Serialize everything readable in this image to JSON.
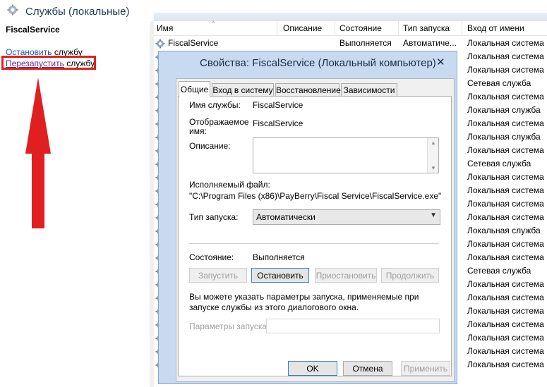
{
  "header": {
    "title": "Службы (локальные)"
  },
  "left_pane": {
    "service_name": "FiscalService",
    "stop_link": "Остановить",
    "stop_suffix": " службу",
    "restart_link": "Перезапустить",
    "restart_suffix": " службу"
  },
  "list": {
    "columns": {
      "name": "Имя",
      "description": "Описание",
      "status": "Состояние",
      "startup_type": "Тип запуска",
      "logon": "Вход от имени"
    },
    "first_row": {
      "name": "FiscalService",
      "status": "Выполняется",
      "startup_type": "Автоматиче..."
    },
    "logon_values": [
      "Локальная система",
      "Локальная система",
      "Локальная система",
      "Сетевая служба",
      "Локальная система",
      "Локальная служба",
      "Локальная система",
      "Локальная служба",
      "Локальная система",
      "Сетевая служба",
      "Локальная система",
      "Локальная система",
      "Локальная система",
      "Локальная система",
      "Локальная служба",
      "Локальная система",
      "Локальная система",
      "Сетевая служба",
      "Локальная система",
      "Локальная система",
      "Локальная система",
      "Локальная система",
      "Локальная система",
      "Локальная система",
      "Локальная система"
    ]
  },
  "dialog": {
    "title": "Свойства: FiscalService (Локальный компьютер)",
    "close": "✕",
    "tabs": [
      "Общие",
      "Вход в систему",
      "Восстановление",
      "Зависимости"
    ],
    "service_name_label": "Имя службы:",
    "service_name_value": "FiscalService",
    "display_name_label_1": "Отображаемое",
    "display_name_label_2": "имя:",
    "display_name_value": "FiscalService",
    "description_label": "Описание:",
    "exe_label": "Исполняемый файл:",
    "exe_value": "\"C:\\Program Files (x86)\\PayBerry\\Fiscal Service\\FiscalService.exe\"",
    "startup_label": "Тип запуска:",
    "startup_value": "Автоматически",
    "state_label": "Состояние:",
    "state_value": "Выполняется",
    "buttons": {
      "start": "Запустить",
      "stop": "Остановить",
      "pause": "Приостановить",
      "resume": "Продолжить"
    },
    "note": "Вы можете указать параметры запуска, применяемые при запуске службы из этого диалогового окна.",
    "params_label": "Параметры запуска:",
    "ok": "OK",
    "cancel": "Отмена",
    "apply": "Применить"
  },
  "colors": {
    "highlight_box": "#e02020",
    "arrow": "#e02020",
    "dialog_frame": "#c8daf0"
  }
}
